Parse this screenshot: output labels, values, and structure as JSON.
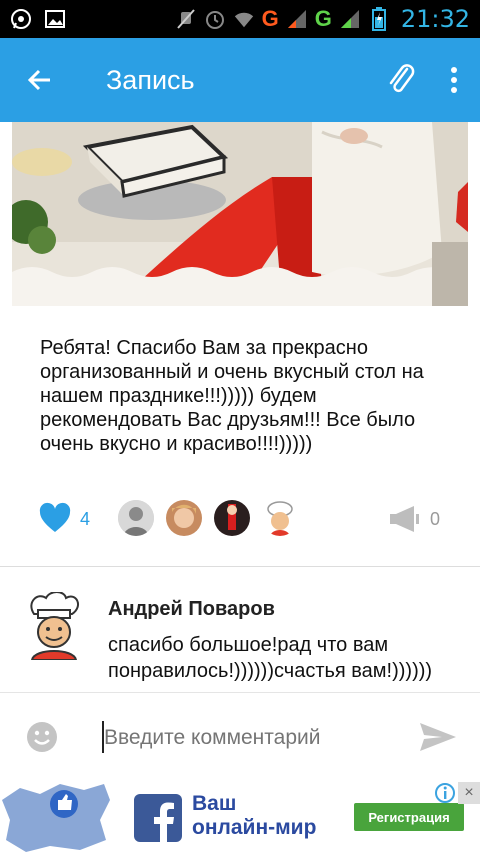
{
  "status_bar": {
    "time": "21:32",
    "network_left": "G",
    "network_right": "G",
    "icons": [
      "whatsapp-icon",
      "gallery-icon",
      "mute-icon",
      "alarm-icon",
      "wifi-icon",
      "signal-icon",
      "battery-icon"
    ]
  },
  "app_bar": {
    "title": "Запись",
    "color": "#2b9fe4"
  },
  "post": {
    "text": "Ребята! Спасибо Вам за прекрасно организованный и очень вкусный стол на нашем празднике!!!))))) будем рекомендовать Вас друзьям!!! Все было очень вкусно и красиво!!!!)))))",
    "likes_count": "4",
    "shares_count": "0"
  },
  "comment": {
    "author": "Андрей Поваров",
    "text": "спасибо большое!рад что вам понравилось!))))))счастья вам!))))))"
  },
  "input": {
    "placeholder": "Введите комментарий"
  },
  "ad": {
    "title_line1": "Ваш",
    "title_line2": "онлайн-мир",
    "button": "Регистрация",
    "close": "×"
  }
}
